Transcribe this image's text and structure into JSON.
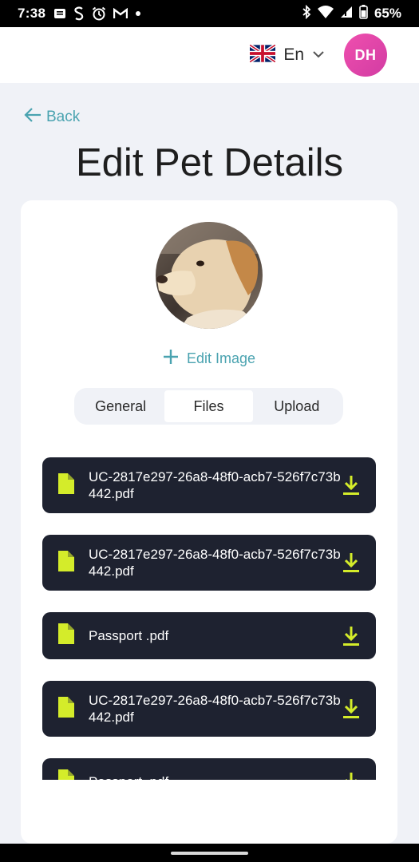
{
  "status_bar": {
    "time": "7:38",
    "battery": "65%",
    "notif_icons": [
      "message-icon",
      "s-icon",
      "alarm-icon",
      "gmail-icon",
      "dot-icon"
    ],
    "sys_icons": [
      "bluetooth-icon",
      "wifi-icon",
      "signal-icon",
      "battery-icon"
    ]
  },
  "header": {
    "language": "En",
    "avatar_initials": "DH",
    "avatar_color": "#e94aaa"
  },
  "back_label": "Back",
  "title": "Edit Pet Details",
  "edit_image_label": "Edit Image",
  "tabs": [
    {
      "label": "General",
      "active": false
    },
    {
      "label": "Files",
      "active": true
    },
    {
      "label": "Upload",
      "active": false
    }
  ],
  "files": [
    {
      "name": "UC-2817e297-26a8-48f0-acb7-526f7c73b442.pdf"
    },
    {
      "name": "UC-2817e297-26a8-48f0-acb7-526f7c73b442.pdf"
    },
    {
      "name": "Passport .pdf"
    },
    {
      "name": "UC-2817e297-26a8-48f0-acb7-526f7c73b442.pdf"
    },
    {
      "name": "Passport .pdf"
    }
  ],
  "colors": {
    "accent": "#4aa3b0",
    "file_row_bg": "#1e2230",
    "file_icon": "#d4ec2a",
    "page_bg": "#f0f2f7"
  }
}
